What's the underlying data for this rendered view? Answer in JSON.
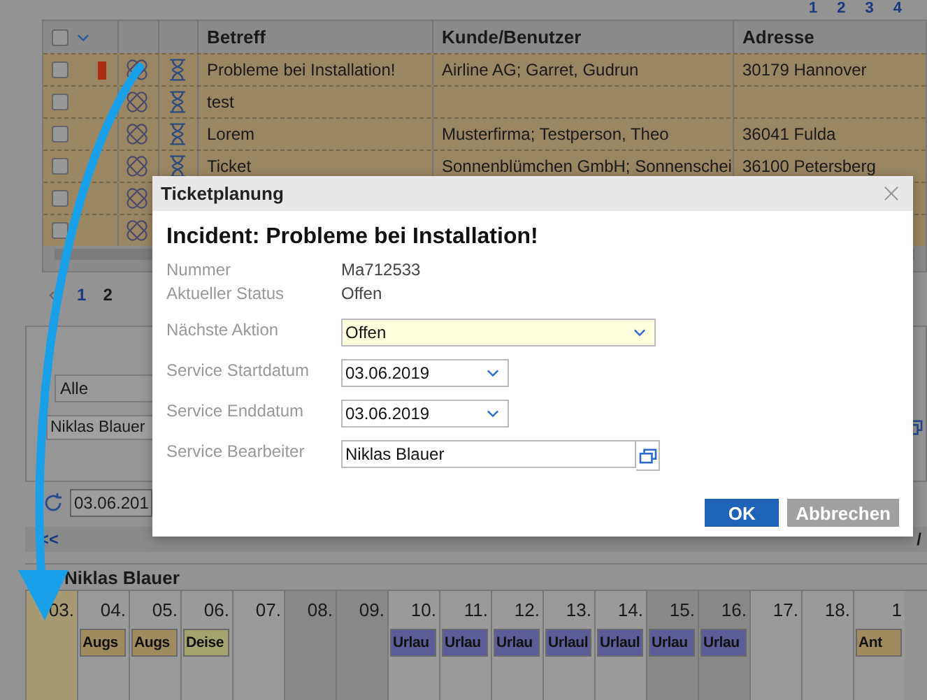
{
  "top_pager": {
    "pages": [
      {
        "label": "1",
        "selected": false
      },
      {
        "label": "2",
        "selected": false
      },
      {
        "label": "3",
        "selected": false
      },
      {
        "label": "4",
        "selected": false
      }
    ]
  },
  "table": {
    "select_all_checked": false,
    "columns": [
      "Betreff",
      "Kunde/Benutzer",
      "Adresse"
    ],
    "rows": [
      {
        "checked": false,
        "flag": true,
        "betreff": "Probleme bei Installation!",
        "kunde": "Airline AG; Garret, Gudrun",
        "adresse": "30179 Hannover"
      },
      {
        "checked": false,
        "flag": false,
        "betreff": "test",
        "kunde": "",
        "adresse": ""
      },
      {
        "checked": false,
        "flag": false,
        "betreff": "Lorem",
        "kunde": "Musterfirma; Testperson, Theo",
        "adresse": "36041 Fulda"
      },
      {
        "checked": false,
        "flag": false,
        "betreff": "Ticket",
        "kunde": "Sonnenblümchen GmbH; Sonnenschei",
        "adresse": "36100 Petersberg"
      },
      {
        "checked": false,
        "flag": false,
        "betreff": "",
        "kunde": "",
        "adresse": ""
      },
      {
        "checked": false,
        "flag": false,
        "betreff": "",
        "kunde": "",
        "adresse": ""
      }
    ]
  },
  "bottom_pager": {
    "pages": [
      {
        "label": "1",
        "selected": false
      },
      {
        "label": "2",
        "selected": true
      }
    ]
  },
  "filters": {
    "group": "Alle",
    "user": "Niklas Blauer"
  },
  "date_field": "03.06.201",
  "nav_prev": "<<",
  "nav_right": "/",
  "calendar": {
    "title": "Niklas Blauer",
    "days": [
      {
        "label": "03.",
        "today": true,
        "weekend": false
      },
      {
        "label": "04.",
        "today": false,
        "weekend": false,
        "entry": {
          "label": "Augs",
          "color": "#a08a60"
        }
      },
      {
        "label": "05.",
        "today": false,
        "weekend": false,
        "entry": {
          "label": "Augs",
          "color": "#a08a60"
        }
      },
      {
        "label": "06.",
        "today": false,
        "weekend": false,
        "entry": {
          "label": "Deise",
          "color": "#a4a470"
        }
      },
      {
        "label": "07.",
        "today": false,
        "weekend": false
      },
      {
        "label": "08.",
        "today": false,
        "weekend": true
      },
      {
        "label": "09.",
        "today": false,
        "weekend": true
      },
      {
        "label": "10.",
        "today": false,
        "weekend": false,
        "entry": {
          "label": "Urlau",
          "color": "#5c5c98"
        }
      },
      {
        "label": "11.",
        "today": false,
        "weekend": false,
        "entry": {
          "label": "Urlau",
          "color": "#5c5c98"
        }
      },
      {
        "label": "12.",
        "today": false,
        "weekend": false,
        "entry": {
          "label": "Urlau",
          "color": "#5c5c98"
        }
      },
      {
        "label": "13.",
        "today": false,
        "weekend": false,
        "entry": {
          "label": "Urlaul",
          "color": "#5c5c98"
        }
      },
      {
        "label": "14.",
        "today": false,
        "weekend": false,
        "entry": {
          "label": "Urlaul",
          "color": "#5c5c98"
        }
      },
      {
        "label": "15.",
        "today": false,
        "weekend": true,
        "entry": {
          "label": "Urlau",
          "color": "#5c5c98"
        }
      },
      {
        "label": "16.",
        "today": false,
        "weekend": true,
        "entry": {
          "label": "Urlau",
          "color": "#5c5c98"
        }
      },
      {
        "label": "17.",
        "today": false,
        "weekend": false
      },
      {
        "label": "18.",
        "today": false,
        "weekend": false
      },
      {
        "label": "1",
        "today": false,
        "weekend": false,
        "entry": {
          "label": "Ant",
          "color": "#a08a60"
        }
      }
    ]
  },
  "dialog": {
    "title": "Ticketplanung",
    "heading": "Incident: Probleme bei Installation!",
    "info": [
      {
        "label": "Nummer",
        "value": "Ma712533"
      },
      {
        "label": "Aktueller Status",
        "value": "Offen"
      }
    ],
    "fields": [
      {
        "kind": "select",
        "label": "Nächste Aktion",
        "value": "Offen",
        "wide": true
      },
      {
        "kind": "select",
        "label": "Service Startdatum",
        "value": "03.06.2019",
        "wide": false
      },
      {
        "kind": "select",
        "label": "Service Enddatum",
        "value": "03.06.2019",
        "wide": false
      },
      {
        "kind": "picker",
        "label": "Service Bearbeiter",
        "value": "Niklas Blauer",
        "wide": true
      }
    ],
    "buttons": [
      {
        "label": "OK",
        "kind": "primary"
      },
      {
        "label": "Abbrechen",
        "kind": "secondary"
      }
    ]
  }
}
